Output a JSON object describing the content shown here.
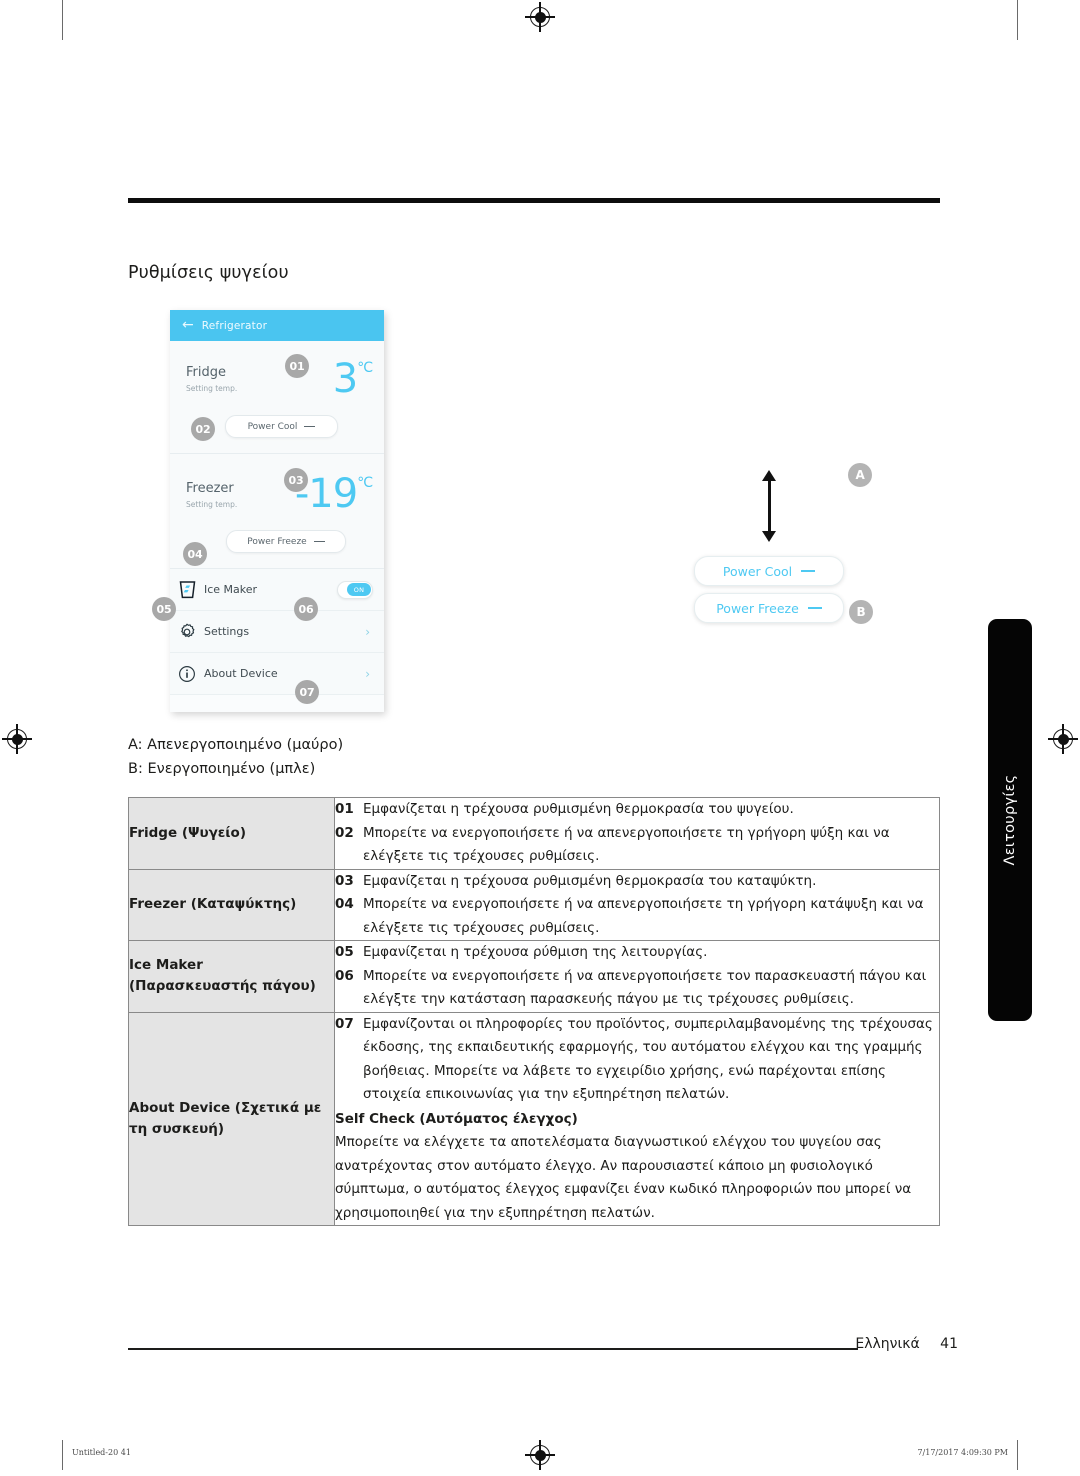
{
  "document": {
    "section_title": "Ρυθμίσεις ψυγείου",
    "footer_language": "Ελληνικά",
    "footer_page": "41",
    "side_tab": "Λειτουργίες",
    "print_file": "Untitled-20   41",
    "print_timestamp": "7/17/2017   4:09:30 PM"
  },
  "mockup": {
    "header": {
      "back_icon": "back-arrow-icon",
      "title": "Refrigerator"
    },
    "fridge": {
      "label": "Fridge",
      "sublabel": "Setting temp.",
      "temperature": "3",
      "degree": "°C",
      "callout": "01",
      "power_cool": {
        "label": "Power Cool",
        "state_icon": "dash-icon",
        "callout": "02"
      }
    },
    "freezer": {
      "label": "Freezer",
      "sublabel": "Setting temp.",
      "temperature": "-19",
      "degree": "°C",
      "callout": "03",
      "power_freeze": {
        "label": "Power Freeze",
        "state_icon": "dash-icon",
        "callout": "04"
      }
    },
    "ice_maker": {
      "label": "Ice Maker",
      "icon": "ice-cup-icon",
      "icon_callout": "05",
      "toggle_callout": "06",
      "toggle_state": "ON"
    },
    "settings": {
      "label": "Settings",
      "icon": "gear-icon",
      "chevron": "›"
    },
    "about_device": {
      "label": "About Device",
      "icon": "info-icon",
      "callout": "07",
      "chevron": "›"
    }
  },
  "callout": {
    "marker_a": "A",
    "marker_b": "B",
    "power_cool": {
      "label": "Power Cool",
      "state_icon": "dash-icon"
    },
    "power_freeze": {
      "label": "Power Freeze",
      "state_icon": "dash-icon"
    },
    "arrow": "double-arrow-vertical-icon"
  },
  "legend": {
    "line_a": "A: Απενεργοποιημένο (μαύρο)",
    "line_b": "B: Ενεργοποιημένο (μπλε)"
  },
  "colors": {
    "accent_cyan": "#4ec9f2",
    "header_cyan": "#4ac5f0",
    "bubble_gray": "#a8a8a8",
    "table_header_bg": "#e4e4e4"
  },
  "table": {
    "rows": [
      {
        "header": "Fridge (Ψυγείο)",
        "items": [
          {
            "num": "01",
            "text": "Εμφανίζεται η τρέχουσα ρυθμισμένη θερμοκρασία του ψυγείου."
          },
          {
            "num": "02",
            "text": "Μπορείτε να ενεργοποιήσετε ή να απενεργοποιήσετε τη γρήγορη ψύξη και να ελέγξετε τις τρέχουσες ρυθμίσεις."
          }
        ]
      },
      {
        "header": "Freezer (Καταψύκτης)",
        "items": [
          {
            "num": "03",
            "text": "Εμφανίζεται η τρέχουσα ρυθμισμένη θερμοκρασία του καταψύκτη."
          },
          {
            "num": "04",
            "text": "Μπορείτε να ενεργοποιήσετε ή να απενεργοποιήσετε τη γρήγορη κατάψυξη και να ελέγξετε τις τρέχουσες ρυθμίσεις."
          }
        ]
      },
      {
        "header": "Ice Maker (Παρασκευαστής πάγου)",
        "items": [
          {
            "num": "05",
            "text": "Εμφανίζεται η τρέχουσα ρύθμιση της λειτουργίας."
          },
          {
            "num": "06",
            "text": "Μπορείτε να ενεργοποιήσετε ή να απενεργοποιήσετε τον παρασκευαστή πάγου και ελέγξτε την κατάσταση παρασκευής πάγου με τις τρέχουσες ρυθμίσεις."
          }
        ]
      },
      {
        "header": "About Device (Σχετικά με τη συσκευή)",
        "items": [
          {
            "num": "07",
            "text": "Εμφανίζονται οι πληροφορίες του προϊόντος, συμπεριλαμβανομένης της τρέχουσας έκδοσης, της εκπαιδευτικής εφαρμογής, του αυτόματου ελέγχου και της γραμμής βοήθειας. Μπορείτε να λάβετε το εγχειρίδιο χρήσης, ενώ παρέχονται επίσης στοιχεία επικοινωνίας για την εξυπηρέτηση πελατών."
          }
        ],
        "subheading": "Self Check (Αυτόματος έλεγχος)",
        "paragraph": "Μπορείτε να ελέγχετε τα αποτελέσματα διαγνωστικού ελέγχου του ψυγείου σας ανατρέχοντας στον αυτόματο έλεγχο. Αν παρουσιαστεί κάποιο μη φυσιολογικό σύμπτωμα, ο αυτόματος έλεγχος εμφανίζει έναν κωδικό πληροφοριών που μπορεί να χρησιμοποιηθεί για την εξυπηρέτηση πελατών."
      }
    ]
  }
}
